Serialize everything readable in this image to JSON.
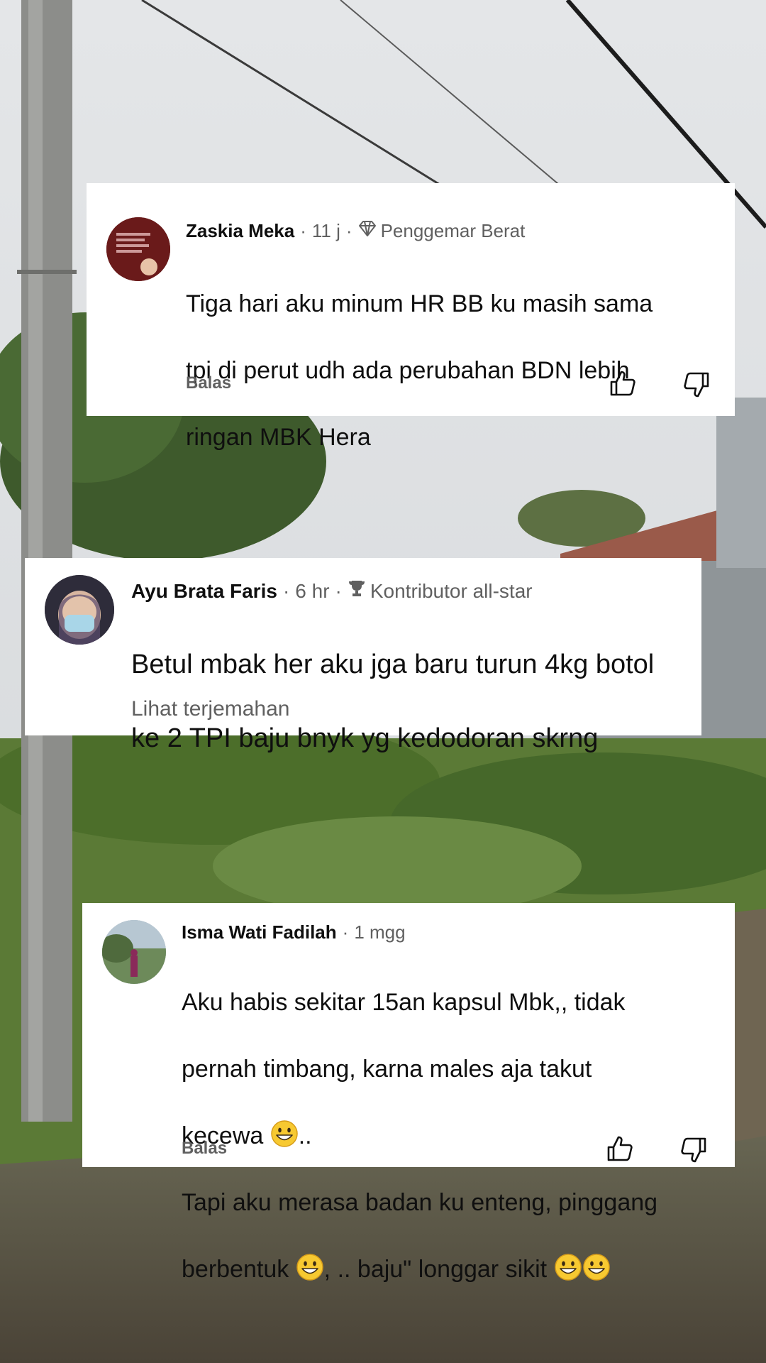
{
  "comments": [
    {
      "author": "Zaskia Meka",
      "time": "11 j",
      "badge_icon": "diamond-icon",
      "badge": "Penggemar Berat",
      "lines": [
        "Tiga hari aku minum HR BB ku masih sama",
        "tpi di perut udh ada perubahan BDN lebih",
        "ringan MBK Hera"
      ],
      "reply_label": "Balas",
      "like_icon": "thumbs-up-icon",
      "dislike_icon": "thumbs-down-icon"
    },
    {
      "author": "Ayu Brata Faris",
      "time": "6 hr",
      "badge_icon": "trophy-icon",
      "badge": "Kontributor all-star",
      "lines": [
        "Betul mbak her aku jga baru turun 4kg botol",
        "ke 2 TPI baju bnyk yg kedodoran skrng"
      ],
      "translate_label": "Lihat terjemahan"
    },
    {
      "author": "Isma Wati Fadilah",
      "time": "1 mgg",
      "lines": {
        "l1": "Aku habis sekitar 15an kapsul Mbk,, tidak",
        "l2": "pernah timbang, karna males aja takut",
        "l3a": "kecewa ",
        "l3b": "..",
        "l4": "Tapi aku merasa badan ku enteng, pinggang",
        "l5a": "berbentuk ",
        "l5b": ", .. baju\" longgar sikit "
      },
      "emoji_icon": "grinning-face-emoji",
      "reply_label": "Balas",
      "like_icon": "thumbs-up-icon",
      "dislike_icon": "thumbs-down-icon"
    }
  ],
  "colors": {
    "card_bg": "#ffffff",
    "text_primary": "#0f0f0f",
    "text_secondary": "#606060",
    "sky": "#dcdfe2"
  }
}
